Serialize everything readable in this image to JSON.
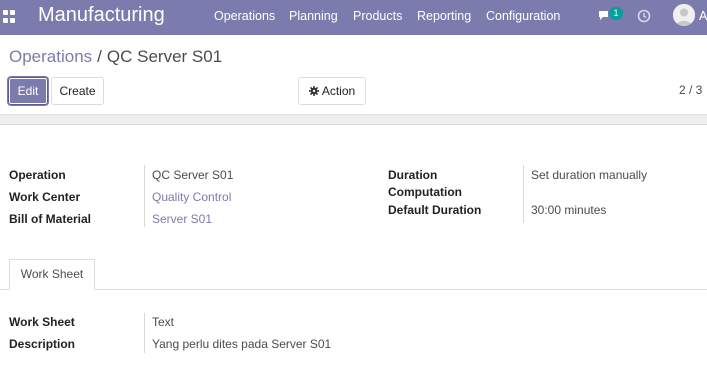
{
  "navbar": {
    "brand": "Manufacturing",
    "menu": [
      "Operations",
      "Planning",
      "Products",
      "Reporting",
      "Configuration"
    ],
    "chat_badge": "1",
    "user_initial": "A"
  },
  "breadcrumb": {
    "parent": "Operations",
    "separator": "/",
    "current": "QC Server S01"
  },
  "buttons": {
    "edit": "Edit",
    "create": "Create",
    "action": "Action"
  },
  "pager": "2 / 3",
  "form": {
    "left": [
      {
        "label": "Operation",
        "value": "QC Server S01"
      },
      {
        "label": "Work Center",
        "value": "Quality Control"
      },
      {
        "label": "Bill of Material",
        "value": "Server S01"
      }
    ],
    "right": {
      "duration_label_line1": "Duration",
      "duration_label_line2": "Computation",
      "duration_value": "Set duration manually",
      "default_label": "Default Duration",
      "default_value": "30:00 minutes"
    }
  },
  "tabs": [
    "Work Sheet"
  ],
  "worksheet": [
    {
      "label": "Work Sheet",
      "value": "Text"
    },
    {
      "label": "Description",
      "value": "Yang perlu dites pada Server S01"
    }
  ],
  "colors": {
    "brand": "#7c7bad",
    "badge": "#00a09d"
  }
}
